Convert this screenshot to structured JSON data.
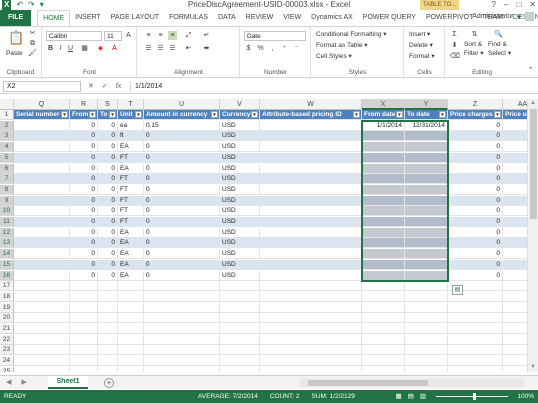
{
  "window": {
    "title": "PriceDiscAgreement-USID-00003.xlsx - Excel",
    "help_label": "?",
    "minimize": "–",
    "restore": "□",
    "close": "✕"
  },
  "qat": [
    "X",
    "↶",
    "↷",
    "▾"
  ],
  "tabs": [
    "FILE",
    "HOME",
    "INSERT",
    "PAGE LAYOUT",
    "FORMULAS",
    "DATA",
    "REVIEW",
    "VIEW",
    "Dynamics AX",
    "POWER QUERY",
    "POWERPIVOT",
    "TEAM",
    "DESIGN"
  ],
  "context_tab": "TABLE TO...",
  "user": "Administrator",
  "ribbon": {
    "clipboard": {
      "paste": "Paste",
      "label": "Clipboard"
    },
    "font": {
      "name": "Calibri",
      "size": "11",
      "label": "Font"
    },
    "alignment": {
      "label": "Alignment"
    },
    "number": {
      "format": "Date",
      "label": "Number"
    },
    "styles": {
      "conditional": "Conditional Formatting ▾",
      "format_table": "Format as Table ▾",
      "cell_styles": "Cell Styles ▾",
      "label": "Styles"
    },
    "cells": {
      "insert": "Insert ▾",
      "delete": "Delete ▾",
      "format": "Format ▾",
      "label": "Cells"
    },
    "editing": {
      "sort": "Sort &",
      "filter": "Filter ▾",
      "find": "Find &",
      "select": "Select ▾",
      "label": "Editing"
    }
  },
  "formula_bar": {
    "name_box": "X2",
    "fx": "fx",
    "value": "1/1/2014"
  },
  "columns": [
    {
      "letter": "",
      "width": 14
    },
    {
      "letter": "Q",
      "width": 56,
      "header": "Serial number"
    },
    {
      "letter": "R",
      "width": 28,
      "header": "From"
    },
    {
      "letter": "S",
      "width": 20,
      "header": "To"
    },
    {
      "letter": "T",
      "width": 26,
      "header": "Unit"
    },
    {
      "letter": "U",
      "width": 76,
      "header": "Amount in currency"
    },
    {
      "letter": "V",
      "width": 40,
      "header": "Currency"
    },
    {
      "letter": "W",
      "width": 102,
      "header": "Attribute-based pricing ID"
    },
    {
      "letter": "X",
      "width": 43,
      "header": "From date"
    },
    {
      "letter": "Y",
      "width": 43,
      "header": "To date"
    },
    {
      "letter": "Z",
      "width": 55,
      "header": "Price charges"
    },
    {
      "letter": "AA",
      "width": 40,
      "header": "Price u"
    }
  ],
  "rows": [
    {
      "n": "2",
      "from": "0",
      "to": "0",
      "unit": "ea",
      "amount": "0.15",
      "currency": "USD",
      "from_date": "1/1/2014",
      "to_date": "12/31/2014",
      "charges": "0"
    },
    {
      "n": "3",
      "from": "0",
      "to": "0",
      "unit": "ft",
      "amount": "0",
      "currency": "USD",
      "from_date": "",
      "to_date": "",
      "charges": "0"
    },
    {
      "n": "4",
      "from": "0",
      "to": "0",
      "unit": "EA",
      "amount": "0",
      "currency": "USD",
      "from_date": "",
      "to_date": "",
      "charges": "0"
    },
    {
      "n": "5",
      "from": "0",
      "to": "0",
      "unit": "FT",
      "amount": "0",
      "currency": "USD",
      "from_date": "",
      "to_date": "",
      "charges": "0"
    },
    {
      "n": "6",
      "from": "0",
      "to": "0",
      "unit": "EA",
      "amount": "0",
      "currency": "USD",
      "from_date": "",
      "to_date": "",
      "charges": "0"
    },
    {
      "n": "7",
      "from": "0",
      "to": "0",
      "unit": "FT",
      "amount": "0",
      "currency": "USD",
      "from_date": "",
      "to_date": "",
      "charges": "0"
    },
    {
      "n": "8",
      "from": "0",
      "to": "0",
      "unit": "FT",
      "amount": "0",
      "currency": "USD",
      "from_date": "",
      "to_date": "",
      "charges": "0"
    },
    {
      "n": "9",
      "from": "0",
      "to": "0",
      "unit": "FT",
      "amount": "0",
      "currency": "USD",
      "from_date": "",
      "to_date": "",
      "charges": "0"
    },
    {
      "n": "10",
      "from": "0",
      "to": "0",
      "unit": "FT",
      "amount": "0",
      "currency": "USD",
      "from_date": "",
      "to_date": "",
      "charges": "0"
    },
    {
      "n": "11",
      "from": "0",
      "to": "0",
      "unit": "FT",
      "amount": "0",
      "currency": "USD",
      "from_date": "",
      "to_date": "",
      "charges": "0"
    },
    {
      "n": "12",
      "from": "0",
      "to": "0",
      "unit": "EA",
      "amount": "0",
      "currency": "USD",
      "from_date": "",
      "to_date": "",
      "charges": "0"
    },
    {
      "n": "13",
      "from": "0",
      "to": "0",
      "unit": "EA",
      "amount": "0",
      "currency": "USD",
      "from_date": "",
      "to_date": "",
      "charges": "0"
    },
    {
      "n": "14",
      "from": "0",
      "to": "0",
      "unit": "EA",
      "amount": "0",
      "currency": "USD",
      "from_date": "",
      "to_date": "",
      "charges": "0"
    },
    {
      "n": "15",
      "from": "0",
      "to": "0",
      "unit": "EA",
      "amount": "0",
      "currency": "USD",
      "from_date": "",
      "to_date": "",
      "charges": "0"
    },
    {
      "n": "16",
      "from": "0",
      "to": "0",
      "unit": "EA",
      "amount": "0",
      "currency": "USD",
      "from_date": "",
      "to_date": "",
      "charges": "0"
    }
  ],
  "empty_rows": [
    "17",
    "18",
    "19",
    "20",
    "21",
    "22",
    "23",
    "24",
    "25",
    "26",
    "27",
    "28"
  ],
  "header_row_num": "1",
  "sheet": {
    "name": "Sheet1",
    "add": "+",
    "nav": [
      "◀",
      "▶"
    ]
  },
  "status": {
    "ready": "READY",
    "average": "AVERAGE: 7/2/2014",
    "count": "COUNT: 2",
    "sum": "SUM: 1/2/2129",
    "zoom": "100%"
  },
  "colors": {
    "accent": "#217346",
    "table_header": "#4f81bd",
    "band": "#dbe5f1"
  }
}
